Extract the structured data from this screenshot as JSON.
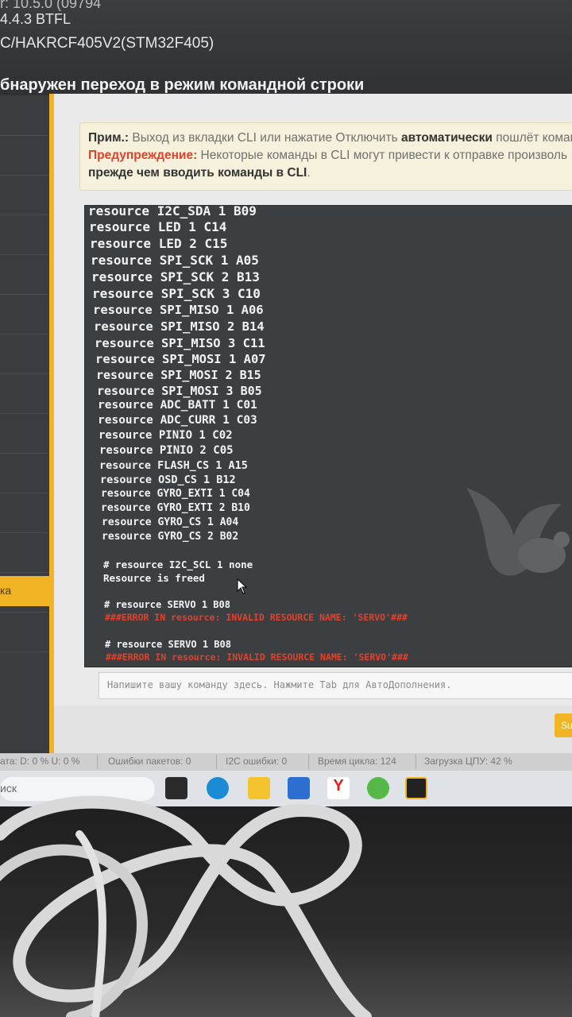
{
  "header": {
    "line1": "r: 10.5.0 (09794",
    "line2": "4.4.3 BTFL",
    "line3": "C/HAKRCF405V2(STM32F405)",
    "cli_message": "бнаружен переход в режим командной строки"
  },
  "nav": {
    "active_label": "ка"
  },
  "notice": {
    "note_label": "Прим.:",
    "note_text": " Выход из вкладки CLI или нажатие Отключить ",
    "note_bold": "автоматически",
    "note_tail": " пошлёт коман",
    "warning_label": "Предупреждение:",
    "warning_text": " Некоторые команды в CLI могут привести к отправке произволь",
    "line3_bold": "прежде чем вводить команды в CLI",
    "line3_tail": "."
  },
  "console": {
    "lines": [
      {
        "text": "resource I2C_SDA 1 B09",
        "type": "out"
      },
      {
        "text": "resource LED 1 C14",
        "type": "out"
      },
      {
        "text": "resource LED 2 C15",
        "type": "out"
      },
      {
        "text": "resource SPI_SCK 1 A05",
        "type": "out"
      },
      {
        "text": "resource SPI_SCK 2 B13",
        "type": "out"
      },
      {
        "text": "resource SPI_SCK 3 C10",
        "type": "out"
      },
      {
        "text": "resource SPI_MISO 1 A06",
        "type": "out"
      },
      {
        "text": "resource SPI_MISO 2 B14",
        "type": "out"
      },
      {
        "text": "resource SPI_MISO 3 C11",
        "type": "out"
      },
      {
        "text": "resource SPI_MOSI 1 A07",
        "type": "out"
      },
      {
        "text": "resource SPI_MOSI 2 B15",
        "type": "out"
      },
      {
        "text": "resource SPI_MOSI 3 B05",
        "type": "out"
      },
      {
        "text": "resource ADC_BATT 1 C01",
        "type": "out"
      },
      {
        "text": "resource ADC_CURR 1 C03",
        "type": "out"
      },
      {
        "text": "resource PINIO 1 C02",
        "type": "out"
      },
      {
        "text": "resource PINIO 2 C05",
        "type": "out"
      },
      {
        "text": "resource FLASH_CS 1 A15",
        "type": "out"
      },
      {
        "text": "resource OSD_CS 1 B12",
        "type": "out"
      },
      {
        "text": "resource GYRO_EXTI 1 C04",
        "type": "out"
      },
      {
        "text": "resource GYRO_EXTI 2 B10",
        "type": "out"
      },
      {
        "text": "resource GYRO_CS 1 A04",
        "type": "out"
      },
      {
        "text": "resource GYRO_CS 2 B02",
        "type": "out"
      },
      {
        "text": "# resource I2C_SCL 1 none",
        "type": "cmd"
      },
      {
        "text": "Resource is freed",
        "type": "out"
      },
      {
        "text": "# resource SERVO 1 B08",
        "type": "cmd"
      },
      {
        "text": "###ERROR IN resource: INVALID RESOURCE NAME: 'SERVO'###",
        "type": "err"
      },
      {
        "text": "# resource SERVO 1 B08",
        "type": "cmd"
      },
      {
        "text": "###ERROR IN resource: INVALID RESOURCE NAME: 'SERVO'###",
        "type": "err"
      }
    ]
  },
  "input": {
    "placeholder": "Напишите вашу команду здесь. Нажмите Tab для АвтоДополнения."
  },
  "footer": {
    "save_label": "Su"
  },
  "statusbar": {
    "items": [
      "ата: D: 0 % U: 0 %",
      "Ошибки пакетов: 0",
      "I2C ошибки: 0",
      "Время цикла: 124",
      "Загрузка ЦПУ: 42 %"
    ]
  },
  "taskbar": {
    "search_label": "иск",
    "icons": [
      "task-view-icon",
      "edge-icon",
      "file-explorer-icon",
      "store-icon",
      "yandex-icon",
      "utorrent-icon",
      "betaflight-icon"
    ]
  },
  "colors": {
    "accent": "#f1b424",
    "error": "#e2412b",
    "console_bg": "#3c3f42"
  }
}
